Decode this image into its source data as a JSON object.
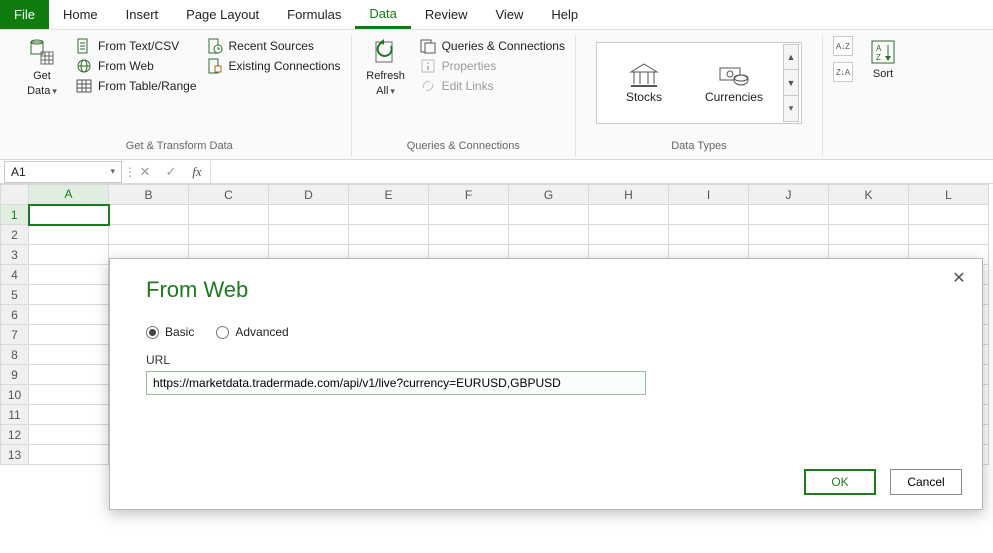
{
  "menu": {
    "items": [
      {
        "label": "File"
      },
      {
        "label": "Home"
      },
      {
        "label": "Insert"
      },
      {
        "label": "Page Layout"
      },
      {
        "label": "Formulas"
      },
      {
        "label": "Data"
      },
      {
        "label": "Review"
      },
      {
        "label": "View"
      },
      {
        "label": "Help"
      }
    ],
    "active_index": 5
  },
  "ribbon": {
    "get_transform": {
      "label": "Get & Transform Data",
      "get_data": {
        "line1": "Get",
        "line2": "Data"
      },
      "items": [
        {
          "label": "From Text/CSV"
        },
        {
          "label": "From Web"
        },
        {
          "label": "From Table/Range"
        }
      ],
      "items2": [
        {
          "label": "Recent Sources"
        },
        {
          "label": "Existing Connections"
        }
      ]
    },
    "queries": {
      "label": "Queries & Connections",
      "refresh": {
        "line1": "Refresh",
        "line2": "All"
      },
      "items": [
        {
          "label": "Queries & Connections",
          "enabled": true
        },
        {
          "label": "Properties",
          "enabled": false
        },
        {
          "label": "Edit Links",
          "enabled": false
        }
      ]
    },
    "data_types": {
      "label": "Data Types",
      "items": [
        {
          "label": "Stocks"
        },
        {
          "label": "Currencies"
        }
      ]
    },
    "sort": {
      "label": "Sort"
    }
  },
  "formula_bar": {
    "name_box": "A1",
    "value": ""
  },
  "grid": {
    "columns": [
      "A",
      "B",
      "C",
      "D",
      "E",
      "F",
      "G",
      "H",
      "I",
      "J",
      "K",
      "L"
    ],
    "rows": [
      1,
      2,
      3,
      4,
      5,
      6,
      7,
      8,
      9,
      10,
      11,
      12,
      13
    ],
    "selected": "A1"
  },
  "dialog": {
    "title": "From Web",
    "basic": "Basic",
    "advanced": "Advanced",
    "url_label": "URL",
    "url_value": "https://marketdata.tradermade.com/api/v1/live?currency=EURUSD,GBPUSD",
    "ok": "OK",
    "cancel": "Cancel"
  }
}
